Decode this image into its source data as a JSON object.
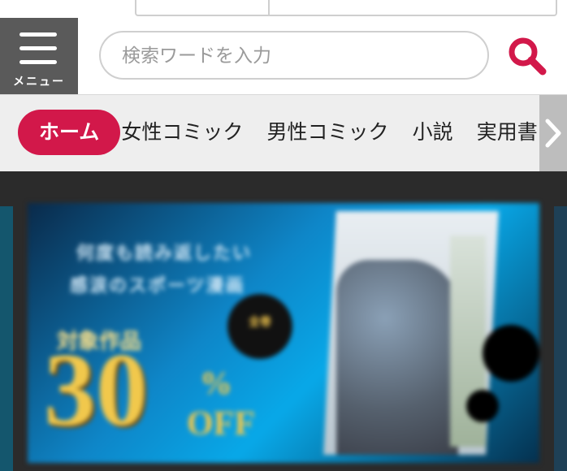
{
  "header": {
    "menu_label": "メニュー",
    "search_placeholder": "検索ワードを入力",
    "accent_color": "#d2184a"
  },
  "nav": {
    "tabs": [
      {
        "label": "ホーム",
        "active": true
      },
      {
        "label": "女性コミック",
        "active": false
      },
      {
        "label": "男性コミック",
        "active": false
      },
      {
        "label": "小説",
        "active": false
      },
      {
        "label": "実用書",
        "active": false
      }
    ],
    "next_icon": "chevron-right-icon"
  },
  "banner": {
    "line1": "何度も読み返したい",
    "line2": "感涙のスポーツ漫画",
    "kicker": "対象作品",
    "badge": "全巻",
    "discount_value": "30",
    "discount_unit": "%",
    "discount_off": "OFF"
  }
}
